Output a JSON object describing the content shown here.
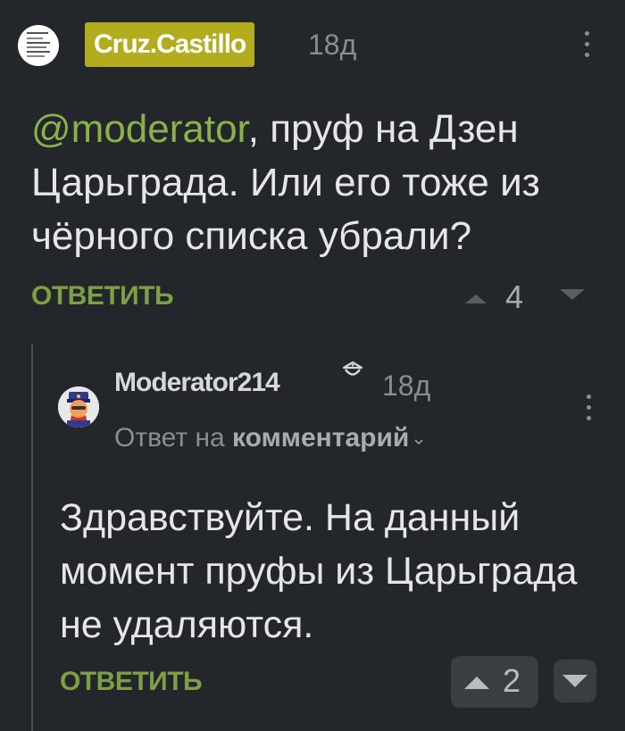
{
  "comment1": {
    "username": "Cruz.Castillo",
    "time": "18д",
    "mention": "@moderator",
    "body_rest": ", пруф на Дзен Царьграда. Или его тоже из чёрного списка убрали?",
    "reply_label": "ОТВЕТИТЬ",
    "votes": "4"
  },
  "comment2": {
    "username": "Moderator214",
    "time": "18д",
    "reply_to_prefix": "Ответ на",
    "reply_to_target": "комментарий",
    "body": "Здравствуйте. На данный момент пруфы из Царьграда не удаляются.",
    "reply_label": "ОТВЕТИТЬ",
    "votes": "2"
  },
  "colors": {
    "background": "#23262a",
    "accent_green": "#7ea044",
    "username_badge": "#b3ac1d",
    "muted": "#8a8d91"
  },
  "icons": [
    "more-vertical-icon",
    "upvote-icon",
    "downvote-icon",
    "moderator-icon",
    "chevron-down-icon"
  ]
}
